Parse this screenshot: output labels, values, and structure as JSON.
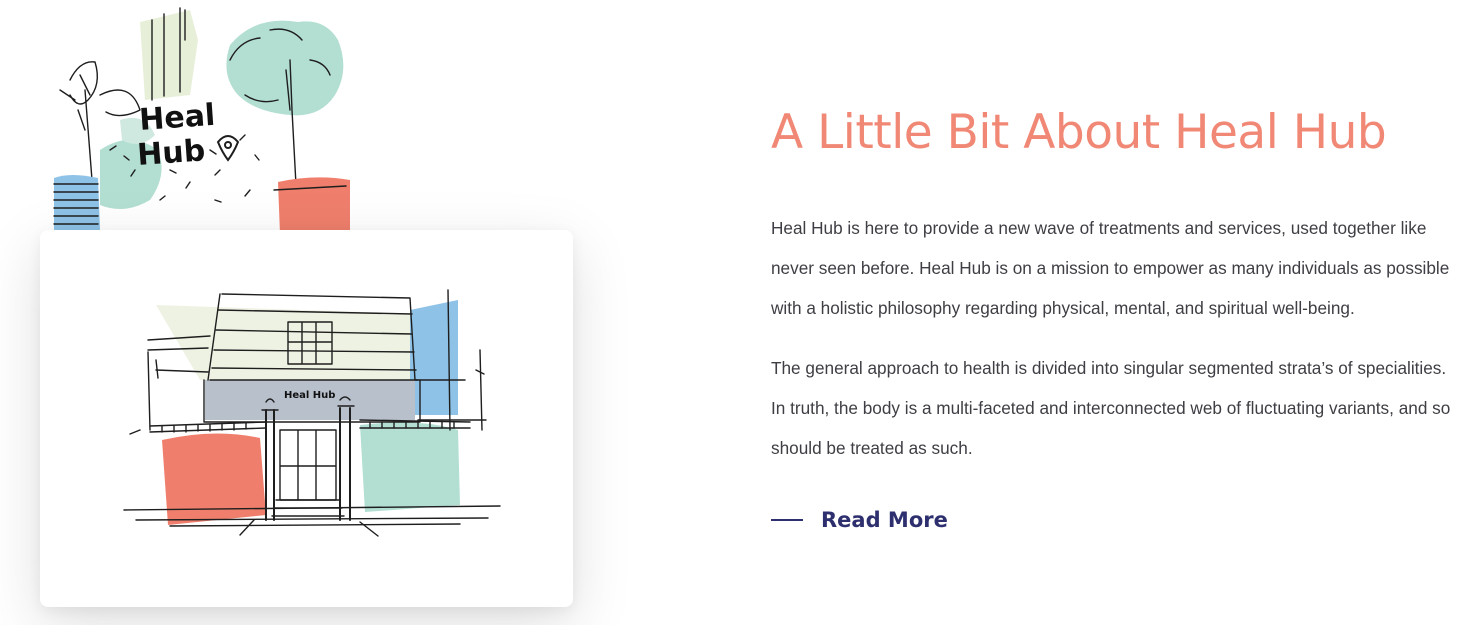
{
  "about": {
    "title": "A Little Bit About Heal Hub",
    "paragraphs": [
      "Heal Hub is here to provide a new wave of treatments and services, used together like never seen before. Heal Hub is on a mission to empower as many individuals as possible with a holistic philosophy regarding physical, mental, and spiritual well-being.",
      "The general approach to health is divided into singular segmented strata’s of specialities. In truth, the body is a multi-faceted and interconnected web of fluctuating variants, and so should be treated as such."
    ],
    "read_more_label": "Read More"
  },
  "logo_sketch": {
    "line1": "Heal",
    "line2": "Hub"
  },
  "storefront_sketch": {
    "sign_text": "Heal Hub"
  },
  "colors": {
    "accent_coral": "#f08875",
    "navy": "#2e2f6e",
    "body_text": "#3e3e44",
    "mint": "#b3dfd2",
    "sky_blue": "#8ec2e6",
    "slate": "#b8c0cc",
    "pale_green": "#e7efd9"
  }
}
